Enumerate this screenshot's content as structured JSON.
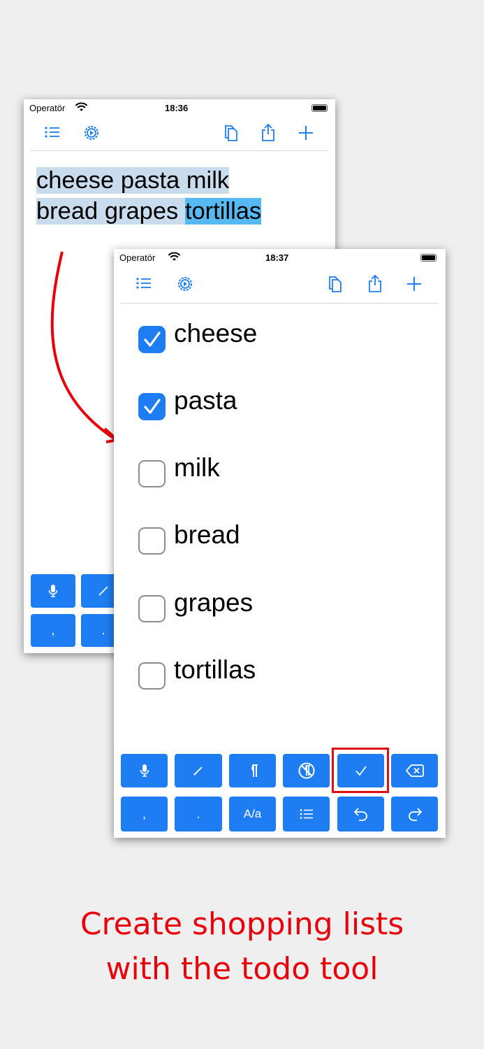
{
  "back_screen": {
    "status": {
      "carrier": "Operatör",
      "time": "18:36"
    },
    "text_lines": [
      {
        "plain": "cheese pasta milk",
        "selected": ""
      },
      {
        "plain": "bread grapes ",
        "selected": "tortillas"
      }
    ],
    "keys": [
      ",",
      "."
    ]
  },
  "front_screen": {
    "status": {
      "carrier": "Operatör",
      "time": "18:37"
    },
    "items": [
      {
        "label": "cheese",
        "checked": true
      },
      {
        "label": "pasta",
        "checked": true
      },
      {
        "label": "milk",
        "checked": false
      },
      {
        "label": "bread",
        "checked": false
      },
      {
        "label": "grapes",
        "checked": false
      },
      {
        "label": "tortillas",
        "checked": false
      }
    ],
    "keyboard_row1_icons": [
      "mic-icon",
      "pencil-icon",
      "pilcrow-icon",
      "no-pilcrow-icon",
      "checkmark-icon",
      "delete-icon"
    ],
    "keyboard_row2": {
      "comma": ",",
      "period": ".",
      "case": "A/a"
    },
    "keyboard_row2_icons": [
      "list-icon",
      "undo-icon",
      "redo-icon"
    ]
  },
  "caption": {
    "line1": "Create shopping lists",
    "line2": "with the todo tool"
  },
  "colors": {
    "accent": "#1f7df3",
    "caption": "#e8000b",
    "highlight": "#e01010"
  }
}
